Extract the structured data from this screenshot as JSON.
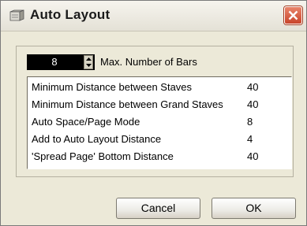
{
  "window": {
    "title": "Auto Layout"
  },
  "spin": {
    "value": "8",
    "label": "Max. Number of Bars"
  },
  "list": [
    {
      "label": "Minimum Distance between Staves",
      "value": "40"
    },
    {
      "label": "Minimum Distance between Grand Staves",
      "value": "40"
    },
    {
      "label": "Auto Space/Page Mode",
      "value": "8"
    },
    {
      "label": "Add to Auto Layout Distance",
      "value": "4"
    },
    {
      "label": "'Spread Page' Bottom Distance",
      "value": "40"
    }
  ],
  "buttons": {
    "cancel": "Cancel",
    "ok": "OK"
  },
  "icons": {
    "title": "score-layout-icon",
    "close": "close-icon"
  }
}
